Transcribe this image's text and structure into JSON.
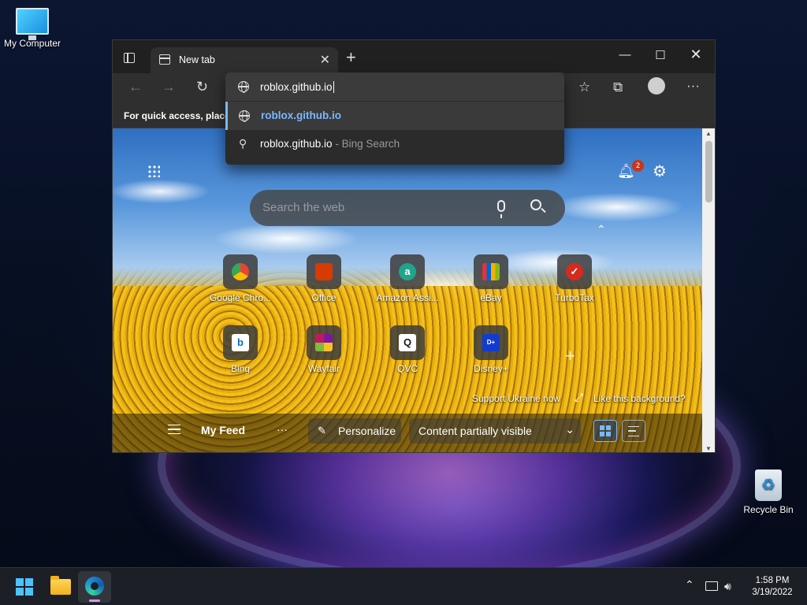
{
  "desktop": {
    "icons": [
      {
        "label": "My Computer",
        "icon": "computer-icon"
      },
      {
        "label": "Recycle Bin",
        "icon": "recycle-bin-icon"
      }
    ]
  },
  "browser": {
    "tab": {
      "title": "New tab"
    },
    "window_controls": {
      "minimize": "—",
      "maximize": "☐",
      "close": "✕"
    },
    "toolbar": {
      "back": "←",
      "forward": "→",
      "refresh": "↻"
    },
    "favorites_bar": {
      "text": "For quick access, place y"
    },
    "address_bar": {
      "value": "roblox.github.io"
    },
    "suggestions": [
      {
        "text": "roblox.github.io",
        "icon": "globe-icon",
        "selected": true
      },
      {
        "text": "roblox.github.io",
        "suffix": "- Bing Search",
        "icon": "search-icon"
      }
    ]
  },
  "new_tab_page": {
    "notifications": {
      "count": "2"
    },
    "search": {
      "placeholder": "Search the web"
    },
    "quick_links": [
      {
        "label": "Google Chro...",
        "icon": "chrome-icon",
        "color": "#db4437"
      },
      {
        "label": "Office",
        "icon": "office-icon",
        "color": "#d83b01"
      },
      {
        "label": "Amazon Assi...",
        "icon": "amazon-icon",
        "color": "#1fa58c"
      },
      {
        "label": "eBay",
        "icon": "ebay-icon",
        "color": "#e53238"
      },
      {
        "label": "TurboTax",
        "icon": "turbotax-icon",
        "color": "#d52b1e"
      },
      {
        "label": "Bing",
        "icon": "bing-icon",
        "color": "#0f6cbd"
      },
      {
        "label": "Wayfair",
        "icon": "wayfair-icon",
        "color": "#7b189f"
      },
      {
        "label": "QVC",
        "icon": "qvc-icon",
        "color": "#1a1a1a"
      },
      {
        "label": "Disney+",
        "icon": "disney-plus-icon",
        "color": "#113ccf"
      }
    ],
    "support_link": "Support Ukraine now",
    "background_link": "Like this background?",
    "feed": {
      "title": "My Feed",
      "more": "···",
      "personalize": "Personalize",
      "content_select": "Content partially visible"
    }
  },
  "taskbar": {
    "clock": {
      "time": "1:58 PM",
      "date": "3/19/2022"
    }
  },
  "colors": {
    "accent": "#7ab8ff",
    "badge": "#c4381e"
  }
}
